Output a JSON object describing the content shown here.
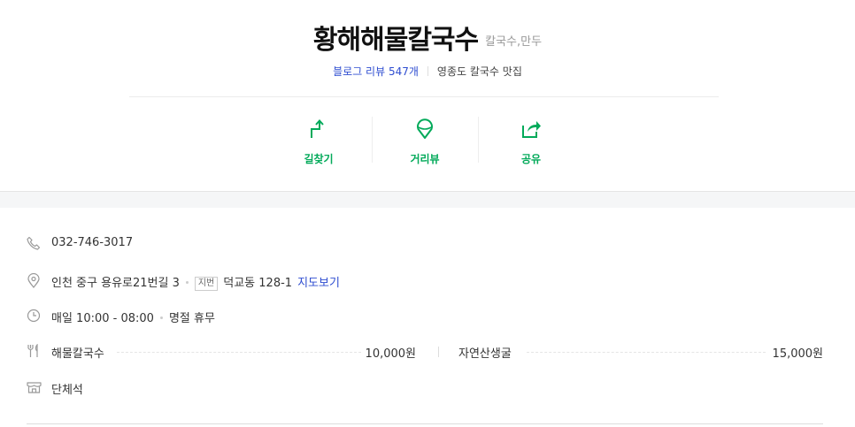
{
  "header": {
    "title": "황해해물칼국수",
    "category": "칼국수,만두",
    "review_link": "블로그 리뷰 547개",
    "keyword": "영종도 칼국수 맛집"
  },
  "actions": [
    {
      "label": "길찾기",
      "icon": "directions-icon"
    },
    {
      "label": "거리뷰",
      "icon": "street-view-icon"
    },
    {
      "label": "공유",
      "icon": "share-icon"
    }
  ],
  "info": {
    "phone": "032-746-3017",
    "address": "인천 중구 용유로21번길 3",
    "lot_tag": "지번",
    "lot_address": "덕교동 128-1",
    "map_link": "지도보기",
    "hours": "매일 10:00 - 08:00",
    "closed": "명절 휴무",
    "menu": [
      {
        "name": "해물칼국수",
        "price": "10,000원"
      },
      {
        "name": "자연산생굴",
        "price": "15,000원"
      }
    ],
    "facility": "단체석"
  },
  "colors": {
    "accent_green": "#03aa5a",
    "link_blue": "#2e4dd0"
  }
}
